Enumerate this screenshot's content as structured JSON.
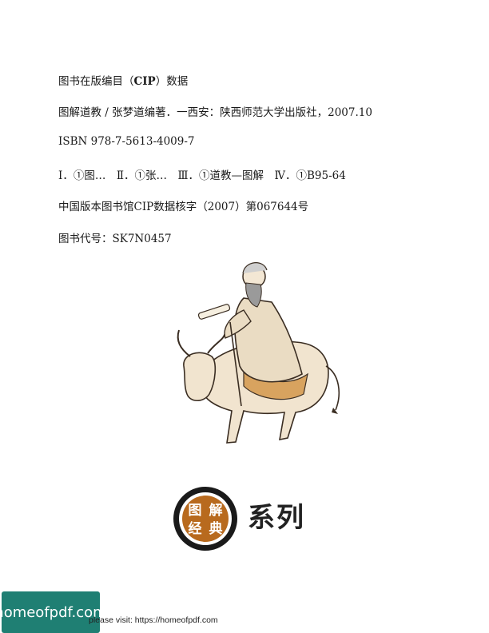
{
  "cip": {
    "heading_prefix": "图书在版编目（",
    "heading_bold": "CIP",
    "heading_suffix": "）数据",
    "title_line": "图解道教 / 张梦道编著．一西安：陕西师范大学出版社，2007.10",
    "isbn": "ISBN 978-7-5613-4009-7",
    "classification": "Ⅰ．①图…　Ⅱ．①张…　Ⅲ．①道教—图解　Ⅳ．①B95-64",
    "cip_record": "中国版本图书馆CIP数据核字（2007）第067644号",
    "book_code": "图书代号：SK7N0457"
  },
  "series_logo": {
    "chars": [
      "图",
      "解",
      "经",
      "典"
    ],
    "label": "系列",
    "colors": {
      "ring": "#1a1a1a",
      "inner": "#b86a1e",
      "text": "#ffffff"
    }
  },
  "illustration": {
    "icon": "sage-riding-ox-icon"
  },
  "footer": {
    "badge_text": "homeofpdf.com",
    "note": "please visit: https://homeofpdf.com"
  }
}
